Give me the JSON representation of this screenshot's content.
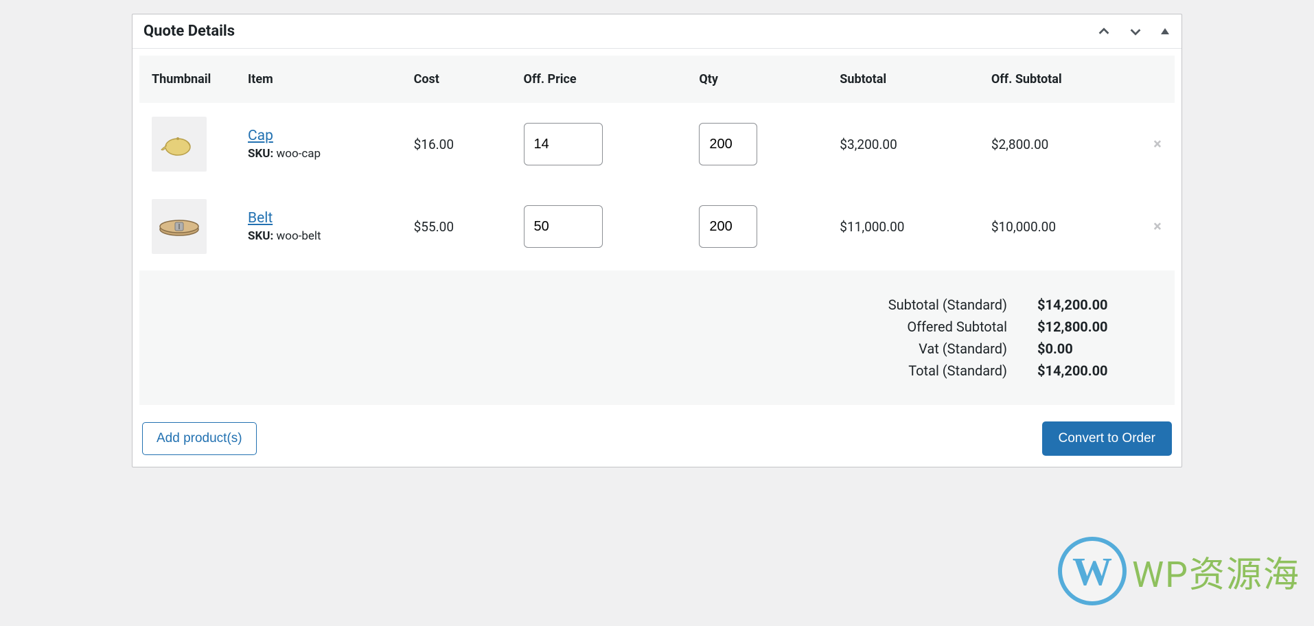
{
  "panel": {
    "title": "Quote Details"
  },
  "columns": {
    "thumbnail": "Thumbnail",
    "item": "Item",
    "cost": "Cost",
    "off_price": "Off. Price",
    "qty": "Qty",
    "subtotal": "Subtotal",
    "off_subtotal": "Off. Subtotal"
  },
  "sku_label": "SKU:",
  "items": [
    {
      "name": "Cap",
      "sku": "woo-cap",
      "cost": "$16.00",
      "off_price": "14",
      "qty": "200",
      "subtotal": "$3,200.00",
      "off_subtotal": "$2,800.00"
    },
    {
      "name": "Belt",
      "sku": "woo-belt",
      "cost": "$55.00",
      "off_price": "50",
      "qty": "200",
      "subtotal": "$11,000.00",
      "off_subtotal": "$10,000.00"
    }
  ],
  "totals": {
    "subtotal_label": "Subtotal (Standard)",
    "subtotal_value": "$14,200.00",
    "offered_label": "Offered Subtotal",
    "offered_value": "$12,800.00",
    "vat_label": "Vat (Standard)",
    "vat_value": "$0.00",
    "total_label": "Total (Standard)",
    "total_value": "$14,200.00"
  },
  "actions": {
    "add_products": "Add product(s)",
    "convert": "Convert to Order"
  },
  "watermark": {
    "letter": "W",
    "text": "WP资源海"
  }
}
